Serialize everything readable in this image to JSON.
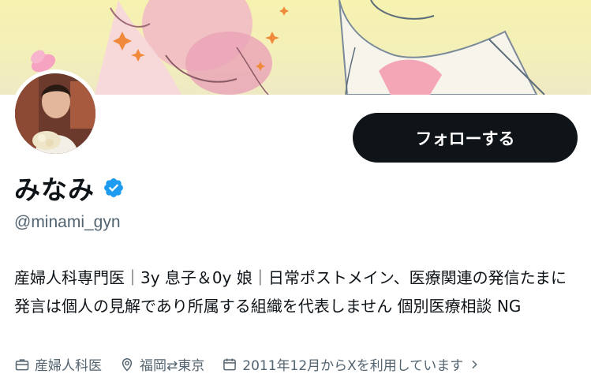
{
  "profile": {
    "display_name": "みなみ",
    "handle": "@minami_gyn",
    "verified": true,
    "follow_label": "フォローする",
    "bio": "産婦人科専門医｜3y 息子＆0y 娘｜日常ポストメイン、医療関連の発信たまに 発言は個人の見解であり所属する組織を代表しません 個別医療相談 NG",
    "meta": {
      "job": "産婦人科医",
      "location": "福岡⇄東京",
      "joined": "2011年12月からXを利用しています"
    }
  },
  "colors": {
    "verified_blue": "#1d9bf0",
    "button_bg": "#0f1419",
    "muted_text": "#536471"
  },
  "icons": {
    "verified": "verified-badge-icon",
    "job": "briefcase-icon",
    "location": "location-pin-icon",
    "joined": "calendar-icon",
    "expand": "chevron-right-icon"
  }
}
